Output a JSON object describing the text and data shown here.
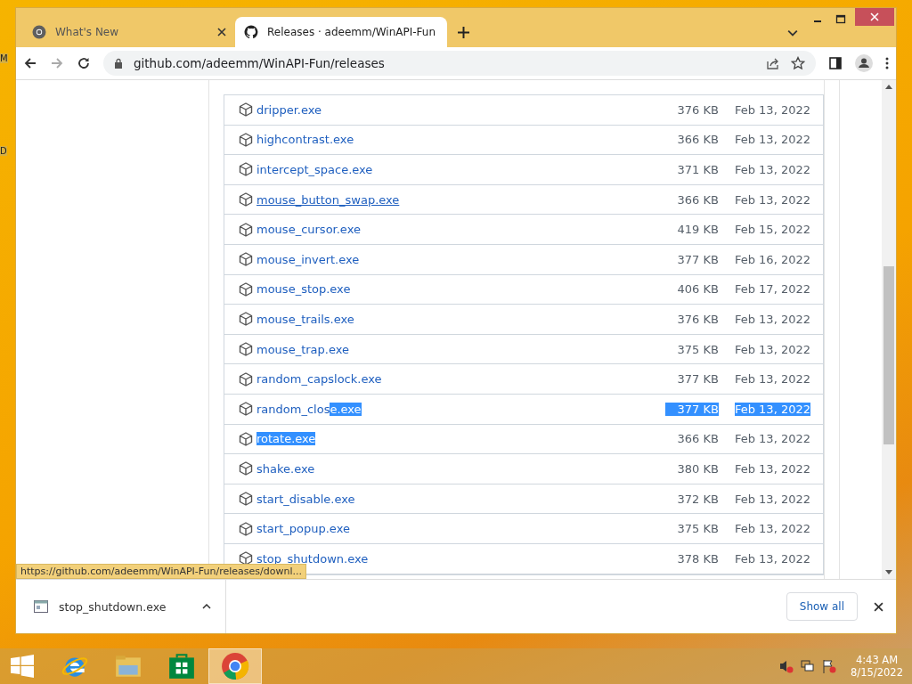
{
  "desktop_fragments": [
    "M",
    "D"
  ],
  "tabs": [
    {
      "title": "What's New",
      "kind": "chrome",
      "selected": false
    },
    {
      "title": "Releases · adeemm/WinAPI-Fun",
      "kind": "github",
      "selected": true
    }
  ],
  "address": "github.com/adeemm/WinAPI-Fun/releases",
  "assets": [
    {
      "name_parts": [
        {
          "text": "dripper.exe",
          "highlighted": false
        }
      ],
      "size": "376 KB",
      "date": "Feb 13, 2022",
      "meta_highlighted": false,
      "hovered": false
    },
    {
      "name_parts": [
        {
          "text": "highcontrast.exe",
          "highlighted": false
        }
      ],
      "size": "366 KB",
      "date": "Feb 13, 2022",
      "meta_highlighted": false,
      "hovered": false
    },
    {
      "name_parts": [
        {
          "text": "intercept_space.exe",
          "highlighted": false
        }
      ],
      "size": "371 KB",
      "date": "Feb 13, 2022",
      "meta_highlighted": false,
      "hovered": false
    },
    {
      "name_parts": [
        {
          "text": "mouse_button_swap.exe",
          "highlighted": false
        }
      ],
      "size": "366 KB",
      "date": "Feb 13, 2022",
      "meta_highlighted": false,
      "hovered": true
    },
    {
      "name_parts": [
        {
          "text": "mouse_cursor.exe",
          "highlighted": false
        }
      ],
      "size": "419 KB",
      "date": "Feb 15, 2022",
      "meta_highlighted": false,
      "hovered": false
    },
    {
      "name_parts": [
        {
          "text": "mouse_invert.exe",
          "highlighted": false
        }
      ],
      "size": "377 KB",
      "date": "Feb 16, 2022",
      "meta_highlighted": false,
      "hovered": false
    },
    {
      "name_parts": [
        {
          "text": "mouse_stop.exe",
          "highlighted": false
        }
      ],
      "size": "406 KB",
      "date": "Feb 17, 2022",
      "meta_highlighted": false,
      "hovered": false
    },
    {
      "name_parts": [
        {
          "text": "mouse_trails.exe",
          "highlighted": false
        }
      ],
      "size": "376 KB",
      "date": "Feb 13, 2022",
      "meta_highlighted": false,
      "hovered": false
    },
    {
      "name_parts": [
        {
          "text": "mouse_trap.exe",
          "highlighted": false
        }
      ],
      "size": "375 KB",
      "date": "Feb 13, 2022",
      "meta_highlighted": false,
      "hovered": false
    },
    {
      "name_parts": [
        {
          "text": "random_capslock.exe",
          "highlighted": false
        }
      ],
      "size": "377 KB",
      "date": "Feb 13, 2022",
      "meta_highlighted": false,
      "hovered": false
    },
    {
      "name_parts": [
        {
          "text": "random_clos",
          "highlighted": false
        },
        {
          "text": "e.exe",
          "highlighted": true
        }
      ],
      "size": "377 KB",
      "date": "Feb 13, 2022",
      "meta_highlighted": true,
      "hovered": false
    },
    {
      "name_parts": [
        {
          "text": "rotate.exe",
          "highlighted": true
        }
      ],
      "size": "366 KB",
      "date": "Feb 13, 2022",
      "meta_highlighted": false,
      "hovered": false
    },
    {
      "name_parts": [
        {
          "text": "shake.exe",
          "highlighted": false
        }
      ],
      "size": "380 KB",
      "date": "Feb 13, 2022",
      "meta_highlighted": false,
      "hovered": false
    },
    {
      "name_parts": [
        {
          "text": "start_disable.exe",
          "highlighted": false
        }
      ],
      "size": "372 KB",
      "date": "Feb 13, 2022",
      "meta_highlighted": false,
      "hovered": false
    },
    {
      "name_parts": [
        {
          "text": "start_popup.exe",
          "highlighted": false
        }
      ],
      "size": "375 KB",
      "date": "Feb 13, 2022",
      "meta_highlighted": false,
      "hovered": false
    },
    {
      "name_parts": [
        {
          "text": "stop_shutdown.exe",
          "highlighted": false
        }
      ],
      "size": "378 KB",
      "date": "Feb 13, 2022",
      "meta_highlighted": false,
      "hovered": false
    }
  ],
  "status_url": "https://github.com/adeemm/WinAPI-Fun/releases/downl...",
  "download": {
    "file": "stop_shutdown.exe",
    "show_all": "Show all"
  },
  "taskbar": {
    "apps": [
      {
        "kind": "ie",
        "selected": false
      },
      {
        "kind": "explorer",
        "selected": false
      },
      {
        "kind": "store",
        "selected": false
      },
      {
        "kind": "chrome",
        "selected": true
      }
    ],
    "time": "4:43 AM",
    "date": "8/15/2022"
  }
}
